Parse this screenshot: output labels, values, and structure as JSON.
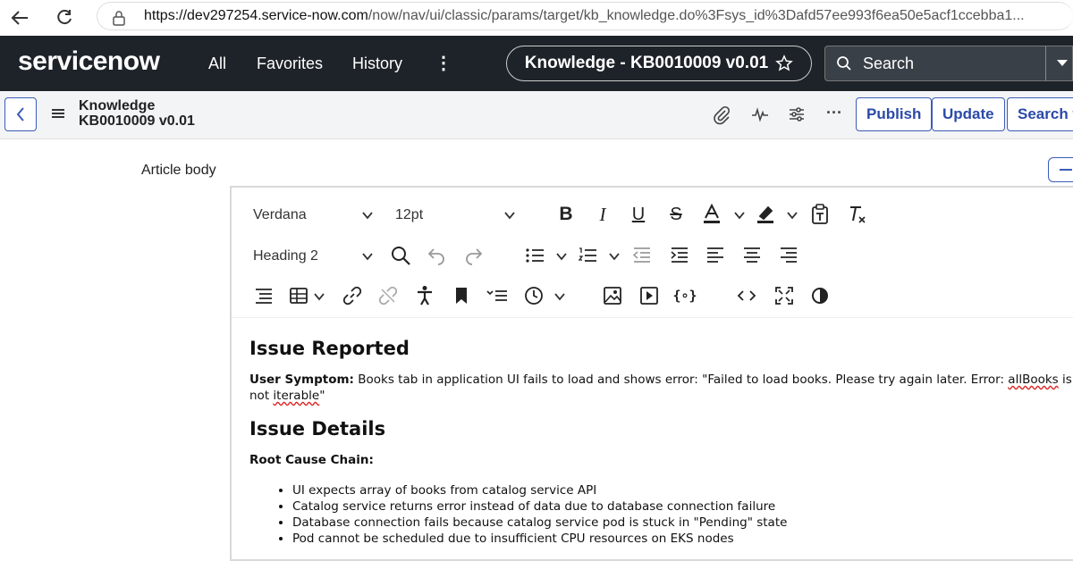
{
  "browser": {
    "url_host": "https://dev297254.service-now.com",
    "url_path": "/now/nav/ui/classic/params/target/kb_knowledge.do%3Fsys_id%3Dafd57ee993f6ea50e5acf1ccebba1..."
  },
  "topnav": {
    "logo": "servicenow",
    "items": [
      "All",
      "Favorites",
      "History"
    ],
    "more": "⋮",
    "context_title": "Knowledge - KB0010009 v0.01",
    "search_placeholder": "Search"
  },
  "formbar": {
    "title_line1": "Knowledge",
    "title_line2": "KB0010009 v0.01",
    "buttons": [
      "Publish",
      "Update",
      "Search fo"
    ]
  },
  "field_label": "Article body",
  "editor": {
    "font": "Verdana",
    "size": "12pt",
    "block": "Heading 2"
  },
  "article": {
    "h1": "Issue Reported",
    "symptom_label": "User Symptom:",
    "symptom_text": " Books tab in application UI fails to load and shows error: \"Failed to load books. Please try again later. Error: ",
    "symptom_err1": "allBooks",
    "symptom_mid": " is not ",
    "symptom_err2": "iterable",
    "symptom_end": "\"",
    "h2": "Issue Details",
    "root_cause_label": "Root Cause Chain:",
    "bullets": [
      "UI expects array of books from catalog service API",
      "Catalog service returns error instead of data due to database connection failure",
      "Database connection fails because catalog service pod is stuck in \"Pending\" state",
      "Pod cannot be scheduled due to insufficient CPU resources on EKS nodes"
    ]
  },
  "colors": {
    "nav_bg": "#1e2329",
    "accent": "#3b5bb8",
    "logo_accent": "#62d84e"
  }
}
